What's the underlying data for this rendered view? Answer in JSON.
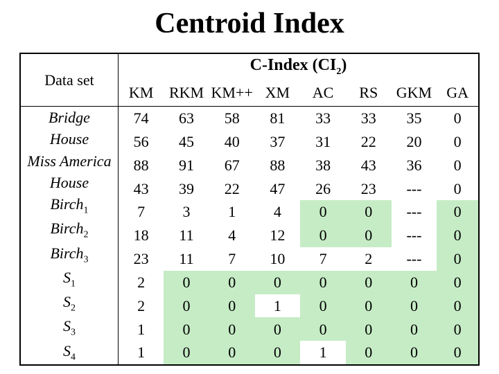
{
  "title": "Centroid Index",
  "header": {
    "dataset_label": "Data set",
    "cindex_label_pre": "C-Index (CI",
    "cindex_sub": "2",
    "cindex_label_post": ")",
    "cols": [
      "KM",
      "RKM",
      "KM++",
      "XM",
      "AC",
      "RS",
      "GKM",
      "GA"
    ]
  },
  "datasets_a": [
    "Bridge",
    "House",
    "Miss America",
    "House"
  ],
  "datasets_b": [
    {
      "name": "Birch",
      "sub": "1"
    },
    {
      "name": "Birch",
      "sub": "2"
    },
    {
      "name": "Birch",
      "sub": "3"
    },
    {
      "name": "S",
      "sub": "1"
    },
    {
      "name": "S",
      "sub": "2"
    },
    {
      "name": "S",
      "sub": "3"
    },
    {
      "name": "S",
      "sub": "4"
    }
  ],
  "rows_a": [
    {
      "KM": "74",
      "RKM": "63",
      "KMpp": "58",
      "XM": "81",
      "AC": "33",
      "RS": "33",
      "GKM": "35",
      "GA": "0"
    },
    {
      "KM": "56",
      "RKM": "45",
      "KMpp": "40",
      "XM": "37",
      "AC": "31",
      "RS": "22",
      "GKM": "20",
      "GA": "0"
    },
    {
      "KM": "88",
      "RKM": "91",
      "KMpp": "67",
      "XM": "88",
      "AC": "38",
      "RS": "43",
      "GKM": "36",
      "GA": "0"
    },
    {
      "KM": "43",
      "RKM": "39",
      "KMpp": "22",
      "XM": "47",
      "AC": "26",
      "RS": "23",
      "GKM": "---",
      "GA": "0"
    }
  ],
  "rows_b": [
    {
      "KM": "7",
      "RKM": "3",
      "KMpp": "1",
      "XM": "4",
      "AC": "0",
      "RS": "0",
      "GKM": "---",
      "GA": "0"
    },
    {
      "KM": "18",
      "RKM": "11",
      "KMpp": "4",
      "XM": "12",
      "AC": "0",
      "RS": "0",
      "GKM": "---",
      "GA": "0"
    },
    {
      "KM": "23",
      "RKM": "11",
      "KMpp": "7",
      "XM": "10",
      "AC": "7",
      "RS": "2",
      "GKM": "---",
      "GA": "0"
    },
    {
      "KM": "2",
      "RKM": "0",
      "KMpp": "0",
      "XM": "0",
      "AC": "0",
      "RS": "0",
      "GKM": "0",
      "GA": "0"
    },
    {
      "KM": "2",
      "RKM": "0",
      "KMpp": "0",
      "XM": "1",
      "AC": "0",
      "RS": "0",
      "GKM": "0",
      "GA": "0"
    },
    {
      "KM": "1",
      "RKM": "0",
      "KMpp": "0",
      "XM": "0",
      "AC": "0",
      "RS": "0",
      "GKM": "0",
      "GA": "0"
    },
    {
      "KM": "1",
      "RKM": "0",
      "KMpp": "0",
      "XM": "0",
      "AC": "1",
      "RS": "0",
      "GKM": "0",
      "GA": "0"
    }
  ],
  "chart_data": {
    "type": "table",
    "title": "Centroid Index — C-Index (CI2)",
    "columns": [
      "Data set",
      "KM",
      "RKM",
      "KM++",
      "XM",
      "AC",
      "RS",
      "GKM",
      "GA"
    ],
    "rows": [
      [
        "Bridge",
        74,
        63,
        58,
        81,
        33,
        33,
        35,
        0
      ],
      [
        "House",
        56,
        45,
        40,
        37,
        31,
        22,
        20,
        0
      ],
      [
        "Miss America",
        88,
        91,
        67,
        88,
        38,
        43,
        36,
        0
      ],
      [
        "House",
        43,
        39,
        22,
        47,
        26,
        23,
        "---",
        0
      ],
      [
        "Birch1",
        7,
        3,
        1,
        4,
        0,
        0,
        "---",
        0
      ],
      [
        "Birch2",
        18,
        11,
        4,
        12,
        0,
        0,
        "---",
        0
      ],
      [
        "Birch3",
        23,
        11,
        7,
        10,
        7,
        2,
        "---",
        0
      ],
      [
        "S1",
        2,
        0,
        0,
        0,
        0,
        0,
        0,
        0
      ],
      [
        "S2",
        2,
        0,
        0,
        1,
        0,
        0,
        0,
        0
      ],
      [
        "S3",
        1,
        0,
        0,
        0,
        0,
        0,
        0,
        0
      ],
      [
        "S4",
        1,
        0,
        0,
        0,
        1,
        0,
        0,
        0
      ]
    ],
    "highlighted_zero_cells": [
      [
        "Birch1",
        "AC"
      ],
      [
        "Birch1",
        "RS"
      ],
      [
        "Birch1",
        "GA"
      ],
      [
        "Birch2",
        "AC"
      ],
      [
        "Birch2",
        "RS"
      ],
      [
        "Birch2",
        "GA"
      ],
      [
        "Birch3",
        "GA"
      ],
      [
        "S1",
        "RKM"
      ],
      [
        "S1",
        "KM++"
      ],
      [
        "S1",
        "XM"
      ],
      [
        "S1",
        "AC"
      ],
      [
        "S1",
        "RS"
      ],
      [
        "S1",
        "GKM"
      ],
      [
        "S1",
        "GA"
      ],
      [
        "S2",
        "RKM"
      ],
      [
        "S2",
        "KM++"
      ],
      [
        "S2",
        "AC"
      ],
      [
        "S2",
        "RS"
      ],
      [
        "S2",
        "GKM"
      ],
      [
        "S2",
        "GA"
      ],
      [
        "S3",
        "RKM"
      ],
      [
        "S3",
        "KM++"
      ],
      [
        "S3",
        "XM"
      ],
      [
        "S3",
        "AC"
      ],
      [
        "S3",
        "RS"
      ],
      [
        "S3",
        "GKM"
      ],
      [
        "S3",
        "GA"
      ],
      [
        "S4",
        "RKM"
      ],
      [
        "S4",
        "KM++"
      ],
      [
        "S4",
        "XM"
      ],
      [
        "S4",
        "RS"
      ],
      [
        "S4",
        "GKM"
      ],
      [
        "S4",
        "GA"
      ]
    ]
  }
}
